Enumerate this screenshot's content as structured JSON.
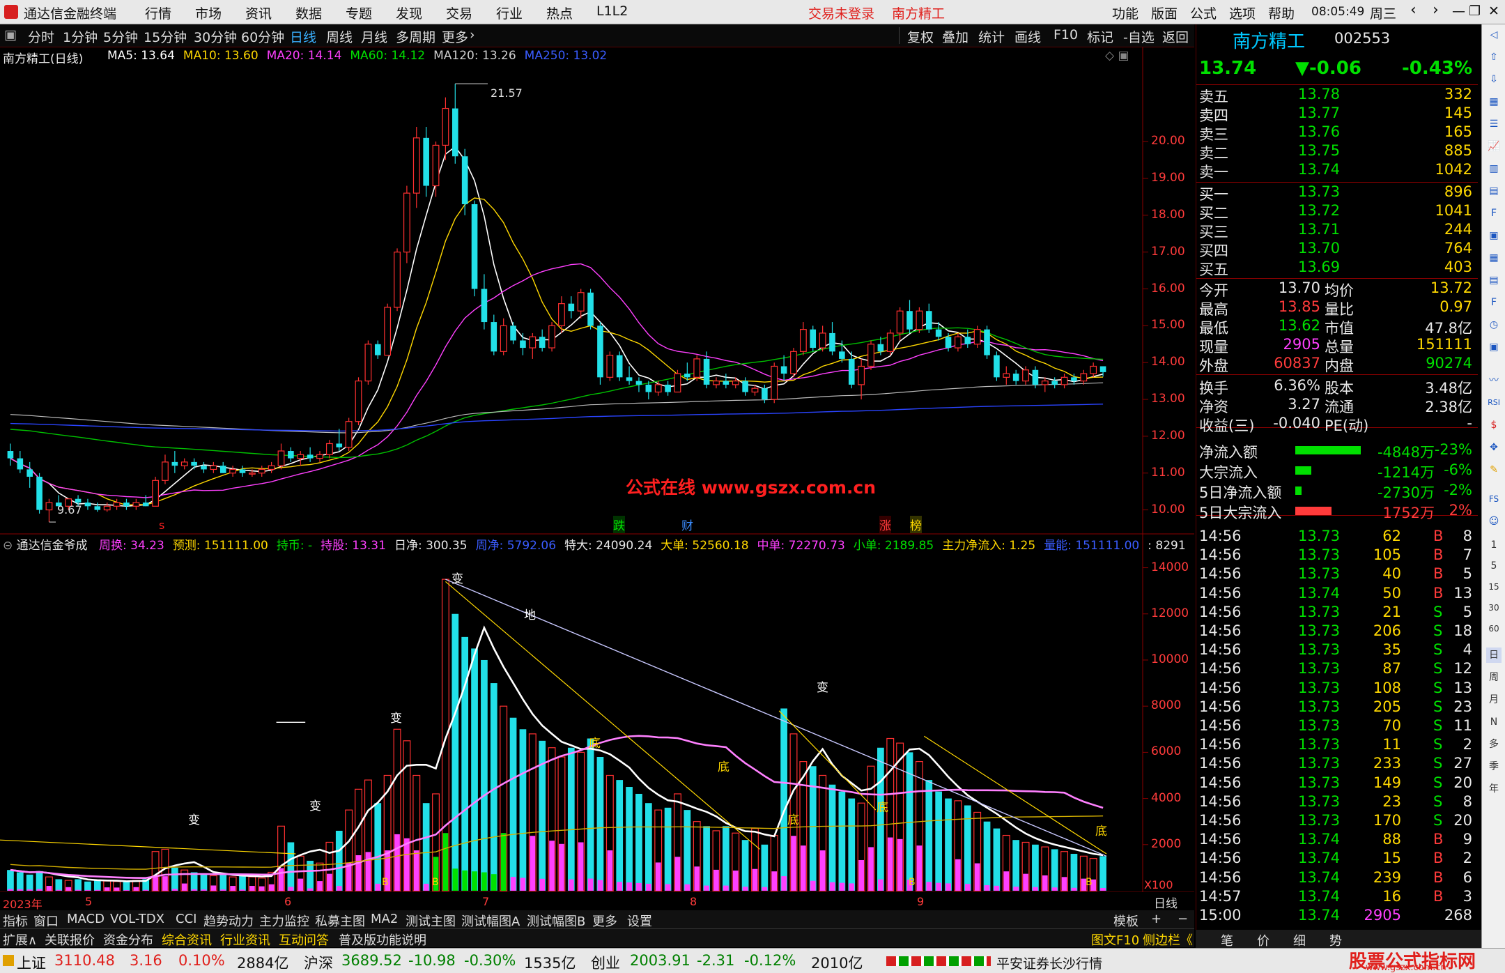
{
  "menubar": {
    "app_title": "通达信金融终端",
    "items": [
      "行情",
      "市场",
      "资讯",
      "数据",
      "专题",
      "发现",
      "交易",
      "行业",
      "热点",
      "L1L2"
    ],
    "login_status": "交易未登录",
    "stock_name": "南方精工",
    "right_items": [
      "功能",
      "版面",
      "公式",
      "选项",
      "帮助"
    ],
    "clock": "08:05:49",
    "weekday": "周三"
  },
  "periods": {
    "items": [
      "分时",
      "1分钟",
      "5分钟",
      "15分钟",
      "30分钟",
      "60分钟",
      "日线",
      "周线",
      "月线",
      "多周期",
      "更多"
    ],
    "active": "日线",
    "tools": [
      "复权",
      "叠加",
      "统计",
      "画线",
      "F10",
      "标记",
      "-自选",
      "返回"
    ]
  },
  "main_chart": {
    "title": "南方精工(日线)",
    "ma_legend": [
      {
        "name": "MA5: 13.64",
        "color": "#ffffff"
      },
      {
        "name": "MA10: 13.60",
        "color": "#ffd800"
      },
      {
        "name": "MA20: 14.14",
        "color": "#ff40ff"
      },
      {
        "name": "MA60: 14.12",
        "color": "#00e000"
      },
      {
        "name": "MA120: 13.26",
        "color": "#d0d0d0"
      },
      {
        "name": "MA250: 13.02",
        "color": "#3a5cff"
      }
    ],
    "y_ticks": [
      "20.00",
      "19.00",
      "18.00",
      "17.00",
      "16.00",
      "15.00",
      "14.00",
      "13.00",
      "12.00",
      "11.00",
      "10.00"
    ],
    "y_min": 9.5,
    "y_max": 21.8,
    "high_label": "21.57",
    "low_label": "9.67",
    "watermark": "公式在线  www.gszx.com.cn",
    "event_marks": [
      {
        "text": "跌",
        "color": "#00e000"
      },
      {
        "text": "财",
        "color": "#3a8cff"
      },
      {
        "text": "涨",
        "color": "#ff3b3b"
      },
      {
        "text": "榜",
        "color": "#ffd800"
      }
    ],
    "s_mark": "s"
  },
  "sub_chart": {
    "title": "通达信金爷成",
    "legend": [
      {
        "text": "周换: 34.23",
        "color": "#ff40ff"
      },
      {
        "text": "预测: 151111.00",
        "color": "#ffd800"
      },
      {
        "text": "持币: -",
        "color": "#00e000"
      },
      {
        "text": "持股: 13.31",
        "color": "#ff40ff"
      },
      {
        "text": "日净: 300.35",
        "color": "#e8e8e8"
      },
      {
        "text": "周净: 5792.06",
        "color": "#3a5cff"
      },
      {
        "text": "特大: 24090.24",
        "color": "#e8e8e8"
      },
      {
        "text": "大单: 52560.18",
        "color": "#ffd800"
      },
      {
        "text": "中单: 72270.73",
        "color": "#ff40ff"
      },
      {
        "text": "小单: 2189.85",
        "color": "#00e000"
      },
      {
        "text": "主力净流入: 1.25",
        "color": "#ffd800"
      },
      {
        "text": "量能: 151111.00",
        "color": "#3a5cff"
      },
      {
        "text": ": 8291",
        "color": "#e8e8e8"
      }
    ],
    "y_ticks": [
      "14000",
      "12000",
      "10000",
      "8000",
      "6000",
      "4000",
      "2000"
    ],
    "y_max": 14500,
    "unit": "X100",
    "marks": [
      "变",
      "底",
      "B",
      "地"
    ],
    "x_labels": [
      "2023年",
      "5",
      "6",
      "7",
      "8",
      "9"
    ],
    "period_label": "日线"
  },
  "quote": {
    "name": "南方精工",
    "code": "002553",
    "price": "13.74",
    "change": "▼-0.06",
    "change_pct": "-0.43%",
    "asks": [
      {
        "label": "卖五",
        "price": "13.78",
        "vol": "332"
      },
      {
        "label": "卖四",
        "price": "13.77",
        "vol": "145"
      },
      {
        "label": "卖三",
        "price": "13.76",
        "vol": "165"
      },
      {
        "label": "卖二",
        "price": "13.75",
        "vol": "885"
      },
      {
        "label": "卖一",
        "price": "13.74",
        "vol": "1042"
      }
    ],
    "bids": [
      {
        "label": "买一",
        "price": "13.73",
        "vol": "896"
      },
      {
        "label": "买二",
        "price": "13.72",
        "vol": "1041"
      },
      {
        "label": "买三",
        "price": "13.71",
        "vol": "244"
      },
      {
        "label": "买四",
        "price": "13.70",
        "vol": "764"
      },
      {
        "label": "买五",
        "price": "13.69",
        "vol": "403"
      }
    ],
    "stats": [
      {
        "l1": "今开",
        "v1": "13.70",
        "c1": "#e8e8e8",
        "l2": "均价",
        "v2": "13.72",
        "c2": "#ffd800"
      },
      {
        "l1": "最高",
        "v1": "13.85",
        "c1": "#ff3b3b",
        "l2": "量比",
        "v2": "0.97",
        "c2": "#ffd800"
      },
      {
        "l1": "最低",
        "v1": "13.62",
        "c1": "#00e000",
        "l2": "市值",
        "v2": "47.8亿",
        "c2": "#e8e8e8"
      },
      {
        "l1": "现量",
        "v1": "2905",
        "c1": "#ff40ff",
        "l2": "总量",
        "v2": "151111",
        "c2": "#ffd800"
      },
      {
        "l1": "外盘",
        "v1": "60837",
        "c1": "#ff3b3b",
        "l2": "内盘",
        "v2": "90274",
        "c2": "#00e000"
      }
    ],
    "stats2": [
      {
        "l1": "换手",
        "v1": "6.36%",
        "l2": "股本",
        "v2": "3.48亿"
      },
      {
        "l1": "净资",
        "v1": "3.27",
        "l2": "流通",
        "v2": "2.38亿"
      },
      {
        "l1": "收益(三)",
        "v1": "-0.040",
        "l2": "PE(动)",
        "v2": "-"
      }
    ],
    "flows": [
      {
        "label": "净流入额",
        "value": "-4848万",
        "pct": "-23%",
        "bar": 0.9,
        "color": "#00e000"
      },
      {
        "label": "大宗流入",
        "value": "-1214万",
        "pct": "-6%",
        "bar": 0.22,
        "color": "#00e000"
      },
      {
        "label": "5日净流入额",
        "value": "-2730万",
        "pct": "-2%",
        "bar": 0.09,
        "color": "#00e000"
      },
      {
        "label": "5日大宗流入",
        "value": "1752万",
        "pct": "2%",
        "bar": 0.5,
        "color": "#ff3b3b"
      }
    ],
    "ticks": [
      {
        "t": "14:56",
        "p": "13.73",
        "v": "62",
        "bs": "B",
        "n": "8"
      },
      {
        "t": "14:56",
        "p": "13.73",
        "v": "105",
        "bs": "B",
        "n": "7"
      },
      {
        "t": "14:56",
        "p": "13.73",
        "v": "40",
        "bs": "B",
        "n": "5"
      },
      {
        "t": "14:56",
        "p": "13.74",
        "v": "50",
        "bs": "B",
        "n": "13"
      },
      {
        "t": "14:56",
        "p": "13.73",
        "v": "21",
        "bs": "S",
        "n": "5"
      },
      {
        "t": "14:56",
        "p": "13.73",
        "v": "206",
        "bs": "S",
        "n": "18"
      },
      {
        "t": "14:56",
        "p": "13.73",
        "v": "35",
        "bs": "S",
        "n": "4"
      },
      {
        "t": "14:56",
        "p": "13.73",
        "v": "87",
        "bs": "S",
        "n": "12"
      },
      {
        "t": "14:56",
        "p": "13.73",
        "v": "108",
        "bs": "S",
        "n": "13"
      },
      {
        "t": "14:56",
        "p": "13.73",
        "v": "205",
        "bs": "S",
        "n": "23"
      },
      {
        "t": "14:56",
        "p": "13.73",
        "v": "70",
        "bs": "S",
        "n": "11"
      },
      {
        "t": "14:56",
        "p": "13.73",
        "v": "11",
        "bs": "S",
        "n": "2"
      },
      {
        "t": "14:56",
        "p": "13.73",
        "v": "233",
        "bs": "S",
        "n": "27"
      },
      {
        "t": "14:56",
        "p": "13.73",
        "v": "149",
        "bs": "S",
        "n": "20"
      },
      {
        "t": "14:56",
        "p": "13.73",
        "v": "23",
        "bs": "S",
        "n": "8"
      },
      {
        "t": "14:56",
        "p": "13.73",
        "v": "170",
        "bs": "S",
        "n": "20"
      },
      {
        "t": "14:56",
        "p": "13.74",
        "v": "88",
        "bs": "B",
        "n": "9"
      },
      {
        "t": "14:56",
        "p": "13.74",
        "v": "15",
        "bs": "B",
        "n": "2"
      },
      {
        "t": "14:56",
        "p": "13.74",
        "v": "239",
        "bs": "B",
        "n": "6"
      },
      {
        "t": "14:57",
        "p": "13.74",
        "v": "16",
        "bs": "B",
        "n": "3"
      },
      {
        "t": "15:00",
        "p": "13.74",
        "v": "2905",
        "bs": "",
        "n": "268"
      }
    ],
    "bottom_tabs": [
      "笔",
      "价",
      "细",
      "势"
    ]
  },
  "tabs1": {
    "items": [
      "指标",
      "窗口",
      "MACD",
      "VOL-TDX",
      "CCI",
      "趋势动力",
      "主力监控",
      "私募主图",
      "MA2",
      "测试主图",
      "测试幅图A",
      "测试幅图B",
      "更多",
      "设置"
    ],
    "right": [
      "模板",
      "+",
      "−"
    ]
  },
  "tabs2": {
    "items": [
      "扩展∧",
      "关联报价",
      "资金分布",
      "综合资讯",
      "行业资讯",
      "互动问答",
      "普及版功能说明"
    ],
    "right": "图文F10",
    "right2": "侧边栏《"
  },
  "status": {
    "sh_label": "上证",
    "sh_value": "3110.48",
    "sh_change": "3.16",
    "sh_pct": "0.10%",
    "sh_amount": "2884亿",
    "hs_label": "沪深",
    "hs_value": "3689.52",
    "hs_change": "-10.98",
    "hs_pct": "-0.30%",
    "hs_amount": "1535亿",
    "cy_label": "创业",
    "cy_value": "2003.91",
    "cy_change": "-2.31",
    "cy_pct": "-0.12%",
    "cy_amount": "2010亿",
    "broker": "平安证券长沙行情",
    "brand": "股票公式指标网",
    "brand_url": "www.gszx.com.cn"
  },
  "chart_data": {
    "type": "candlestick",
    "title": "南方精工(日线)",
    "candles": [
      [
        11.6,
        11.8,
        11.2,
        11.4
      ],
      [
        11.4,
        11.6,
        11.0,
        11.1
      ],
      [
        11.1,
        11.3,
        10.6,
        10.9
      ],
      [
        10.9,
        11.0,
        9.9,
        10.0
      ],
      [
        10.0,
        10.3,
        9.67,
        10.2
      ],
      [
        10.2,
        10.4,
        10.0,
        10.1
      ],
      [
        10.1,
        10.3,
        10.0,
        10.3
      ],
      [
        10.3,
        10.4,
        10.1,
        10.2
      ],
      [
        10.2,
        10.3,
        10.0,
        10.1
      ],
      [
        10.1,
        10.2,
        9.95,
        10.0
      ],
      [
        10.0,
        10.2,
        9.95,
        10.1
      ],
      [
        10.1,
        10.3,
        10.0,
        10.2
      ],
      [
        10.2,
        10.3,
        10.0,
        10.1
      ],
      [
        10.1,
        10.3,
        10.0,
        10.2
      ],
      [
        10.2,
        10.4,
        10.1,
        10.1
      ],
      [
        10.1,
        10.9,
        10.1,
        10.8
      ],
      [
        10.8,
        11.5,
        10.7,
        11.3
      ],
      [
        11.3,
        11.6,
        11.0,
        11.2
      ],
      [
        11.2,
        11.4,
        11.1,
        11.3
      ],
      [
        11.3,
        11.4,
        11.1,
        11.2
      ],
      [
        11.2,
        11.3,
        11.0,
        11.1
      ],
      [
        11.1,
        11.3,
        11.0,
        11.2
      ],
      [
        11.2,
        11.3,
        11.0,
        11.0
      ],
      [
        11.0,
        11.2,
        10.9,
        11.1
      ],
      [
        11.1,
        11.2,
        10.9,
        11.0
      ],
      [
        11.0,
        11.1,
        10.9,
        11.0
      ],
      [
        11.0,
        11.2,
        10.9,
        11.1
      ],
      [
        11.1,
        11.3,
        11.0,
        11.2
      ],
      [
        11.2,
        11.8,
        11.1,
        11.6
      ],
      [
        11.6,
        11.7,
        11.3,
        11.4
      ],
      [
        11.4,
        11.6,
        11.2,
        11.5
      ],
      [
        11.5,
        11.7,
        11.3,
        11.4
      ],
      [
        11.4,
        11.6,
        11.3,
        11.5
      ],
      [
        11.5,
        11.9,
        11.4,
        11.8
      ],
      [
        11.8,
        12.2,
        11.6,
        11.7
      ],
      [
        11.7,
        12.5,
        11.6,
        12.4
      ],
      [
        12.4,
        13.6,
        12.3,
        13.5
      ],
      [
        13.5,
        14.6,
        13.4,
        14.5
      ],
      [
        14.5,
        14.6,
        14.1,
        14.2
      ],
      [
        14.2,
        15.6,
        14.2,
        15.5
      ],
      [
        15.5,
        17.1,
        15.4,
        17.0
      ],
      [
        17.0,
        18.8,
        16.7,
        18.6
      ],
      [
        18.6,
        20.4,
        18.2,
        20.1
      ],
      [
        20.1,
        20.4,
        18.5,
        18.8
      ],
      [
        18.8,
        20.0,
        18.5,
        19.9
      ],
      [
        19.9,
        21.2,
        19.5,
        20.9
      ],
      [
        20.9,
        21.57,
        19.4,
        19.6
      ],
      [
        19.6,
        19.8,
        18.0,
        18.3
      ],
      [
        18.3,
        18.4,
        15.8,
        16.0
      ],
      [
        16.0,
        16.4,
        14.9,
        15.1
      ],
      [
        15.1,
        15.3,
        14.2,
        14.3
      ],
      [
        14.3,
        15.2,
        14.2,
        15.0
      ],
      [
        15.0,
        15.1,
        14.5,
        14.6
      ],
      [
        14.6,
        14.8,
        14.2,
        14.4
      ],
      [
        14.4,
        14.8,
        14.1,
        14.7
      ],
      [
        14.7,
        14.9,
        14.3,
        14.4
      ],
      [
        14.4,
        15.1,
        14.3,
        15.0
      ],
      [
        15.0,
        15.8,
        14.8,
        15.6
      ],
      [
        15.6,
        15.8,
        15.2,
        15.4
      ],
      [
        15.4,
        16.0,
        15.2,
        15.9
      ],
      [
        15.9,
        16.0,
        14.9,
        15.0
      ],
      [
        15.0,
        15.1,
        13.4,
        13.6
      ],
      [
        13.6,
        14.3,
        13.5,
        14.2
      ],
      [
        14.2,
        14.3,
        13.5,
        13.6
      ],
      [
        13.6,
        13.9,
        13.4,
        13.5
      ],
      [
        13.5,
        13.6,
        13.2,
        13.4
      ],
      [
        13.4,
        13.5,
        13.0,
        13.2
      ],
      [
        13.2,
        13.5,
        13.1,
        13.4
      ],
      [
        13.4,
        13.5,
        13.1,
        13.2
      ],
      [
        13.2,
        13.8,
        13.2,
        13.7
      ],
      [
        13.7,
        14.0,
        13.5,
        13.6
      ],
      [
        13.6,
        14.2,
        13.5,
        14.1
      ],
      [
        14.1,
        14.3,
        13.3,
        13.4
      ],
      [
        13.4,
        13.6,
        13.3,
        13.5
      ],
      [
        13.5,
        13.7,
        13.3,
        13.4
      ],
      [
        13.4,
        13.6,
        13.3,
        13.5
      ],
      [
        13.5,
        13.6,
        13.1,
        13.2
      ],
      [
        13.2,
        13.4,
        13.1,
        13.3
      ],
      [
        13.3,
        13.4,
        12.9,
        13.0
      ],
      [
        13.0,
        14.0,
        12.9,
        13.9
      ],
      [
        13.9,
        14.2,
        13.5,
        13.7
      ],
      [
        13.7,
        14.4,
        13.6,
        14.3
      ],
      [
        14.3,
        15.1,
        14.2,
        14.9
      ],
      [
        14.9,
        15.0,
        14.3,
        14.4
      ],
      [
        14.4,
        15.0,
        14.3,
        14.8
      ],
      [
        14.8,
        15.1,
        14.2,
        14.3
      ],
      [
        14.3,
        14.6,
        14.0,
        14.1
      ],
      [
        14.1,
        14.3,
        13.3,
        13.4
      ],
      [
        13.4,
        14.1,
        13.0,
        13.9
      ],
      [
        13.9,
        14.6,
        13.8,
        14.5
      ],
      [
        14.5,
        14.7,
        14.2,
        14.3
      ],
      [
        14.3,
        14.9,
        14.2,
        14.8
      ],
      [
        14.8,
        15.5,
        14.6,
        15.4
      ],
      [
        15.4,
        15.7,
        14.8,
        14.9
      ],
      [
        14.9,
        15.5,
        14.8,
        15.4
      ],
      [
        15.4,
        15.6,
        14.8,
        14.9
      ],
      [
        14.9,
        15.1,
        14.6,
        14.7
      ],
      [
        14.7,
        14.8,
        14.3,
        14.4
      ],
      [
        14.4,
        14.8,
        14.3,
        14.7
      ],
      [
        14.7,
        14.9,
        14.4,
        14.5
      ],
      [
        14.5,
        15.0,
        14.4,
        14.9
      ],
      [
        14.9,
        15.0,
        14.1,
        14.2
      ],
      [
        14.2,
        14.3,
        13.5,
        13.6
      ],
      [
        13.6,
        13.9,
        13.4,
        13.7
      ],
      [
        13.7,
        13.8,
        13.4,
        13.5
      ],
      [
        13.5,
        13.9,
        13.4,
        13.8
      ],
      [
        13.8,
        13.9,
        13.3,
        13.4
      ],
      [
        13.4,
        13.6,
        13.2,
        13.5
      ],
      [
        13.5,
        13.6,
        13.3,
        13.4
      ],
      [
        13.4,
        13.7,
        13.3,
        13.6
      ],
      [
        13.6,
        13.7,
        13.4,
        13.5
      ],
      [
        13.5,
        13.8,
        13.4,
        13.7
      ],
      [
        13.7,
        14.0,
        13.6,
        13.9
      ],
      [
        13.9,
        13.9,
        13.62,
        13.74
      ]
    ],
    "volume": [
      900,
      800,
      700,
      850,
      600,
      500,
      450,
      500,
      400,
      450,
      420,
      400,
      380,
      450,
      500,
      1700,
      1800,
      1000,
      900,
      800,
      700,
      650,
      700,
      600,
      650,
      600,
      550,
      800,
      2800,
      2100,
      1500,
      1300,
      1200,
      2100,
      2600,
      3500,
      4400,
      4800,
      3800,
      5000,
      7000,
      6500,
      5000,
      3800,
      4200,
      13500,
      12000,
      11000,
      10500,
      10000,
      9000,
      8000,
      7500,
      7000,
      6800,
      6500,
      6200,
      5800,
      6200,
      6000,
      6600,
      5800,
      5000,
      4800,
      4500,
      4200,
      3800,
      3500,
      3600,
      4200,
      3500,
      3000,
      2800,
      2600,
      2800,
      2500,
      2200,
      2700,
      2000,
      2400,
      7900,
      6800,
      5600,
      5400,
      5000,
      4600,
      4300,
      4000,
      3800,
      5400,
      6200,
      6600,
      6400,
      6000,
      5600,
      4800,
      4300,
      4000,
      3900,
      3700,
      3400,
      3000,
      2700,
      2400,
      2200,
      2100,
      2000,
      1900,
      1800,
      1700,
      1600,
      1500,
      1400,
      1500
    ],
    "y_range": [
      9.5,
      21.8
    ],
    "vol_range": [
      0,
      14500
    ]
  }
}
